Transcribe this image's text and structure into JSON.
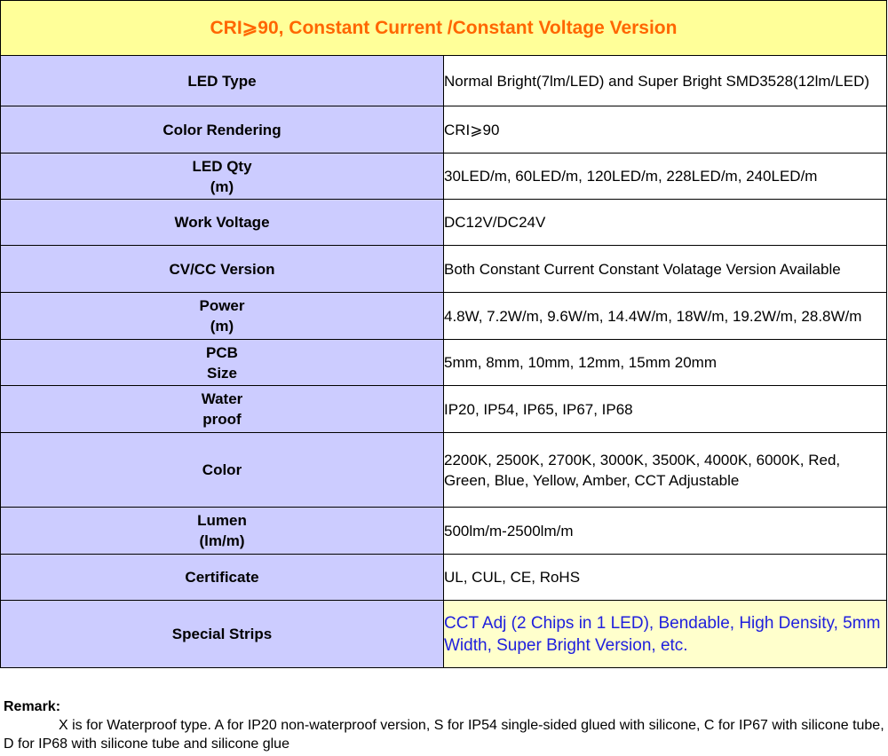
{
  "title": "CRI⩾90, Constant Current /Constant Voltage Version",
  "rows": [
    {
      "label": "LED Type",
      "value": "Normal Bright(7lm/LED) and Super Bright SMD3528(12lm/LED)"
    },
    {
      "label": "Color Rendering",
      "value": "CRI⩾90"
    },
    {
      "label": "LED Qty\n(m)",
      "value": "30LED/m, 60LED/m, 120LED/m, 228LED/m, 240LED/m"
    },
    {
      "label": "Work Voltage",
      "value": "DC12V/DC24V"
    },
    {
      "label": "CV/CC Version",
      "value": "Both Constant Current Constant Volatage Version Available"
    },
    {
      "label": "Power\n(m)",
      "value": "4.8W, 7.2W/m, 9.6W/m, 14.4W/m, 18W/m, 19.2W/m, 28.8W/m"
    },
    {
      "label": "PCB\nSize",
      "value": "5mm, 8mm, 10mm, 12mm, 15mm 20mm"
    },
    {
      "label": "Water\nproof",
      "value": "IP20, IP54, IP65, IP67, IP68"
    },
    {
      "label": "Color",
      "value": "2200K, 2500K, 2700K, 3000K, 3500K, 4000K, 6000K,  Red, Green, Blue, Yellow, Amber, CCT Adjustable"
    },
    {
      "label": "Lumen\n(lm/m)",
      "value": "500lm/m-2500lm/m"
    },
    {
      "label": "Certificate",
      "value": "UL, CUL, CE, RoHS"
    },
    {
      "label": "Special Strips",
      "value": "CCT Adj (2 Chips in 1 LED), Bendable, High Density, 5mm Width, Super Bright Version, etc."
    }
  ],
  "remark": {
    "title": "Remark:",
    "text": "X is for Waterproof type. A for IP20 non-waterproof version, S for IP54 single-sided glued with silicone,  C for IP67 with silicone tube, D for IP68 with silicone tube and silicone glue"
  }
}
